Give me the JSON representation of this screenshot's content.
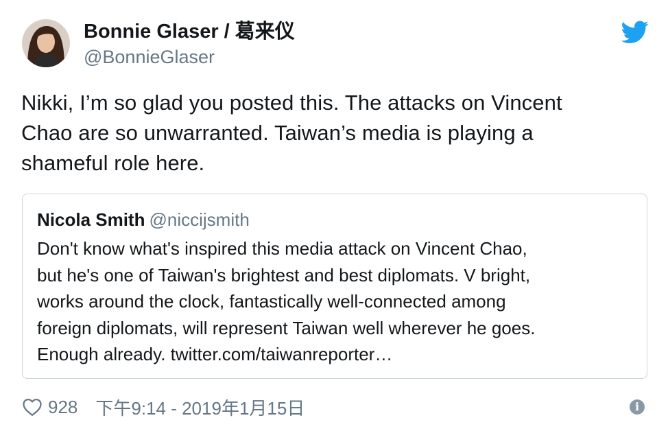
{
  "author": {
    "name": "Bonnie Glaser / 葛来仪",
    "handle": "@BonnieGlaser",
    "avatar_icon": "profile-photo"
  },
  "tweet": {
    "text": "Nikki, I’m so glad you posted this. The attacks on Vincent\nChao are so unwarranted. Taiwan’s media is playing a\nshameful role here."
  },
  "quoted_tweet": {
    "name": "Nicola Smith",
    "handle": "@niccijsmith",
    "text": "Don't know what's inspired this media attack on Vincent Chao,\nbut he's one of Taiwan's brightest and best diplomats. V bright,\nworks around the clock, fantastically well-connected among\nforeign diplomats, will represent Taiwan well wherever he goes.\nEnough already. twitter.com/taiwanreporter…"
  },
  "footer": {
    "like_count": "928",
    "timestamp": "下午9:14 - 2019年1月15日",
    "like_icon": "heart-icon",
    "info_icon": "info-icon"
  },
  "colors": {
    "twitter_blue": "#1da1f2",
    "secondary_text": "#657786",
    "border": "#ccd6dd"
  }
}
